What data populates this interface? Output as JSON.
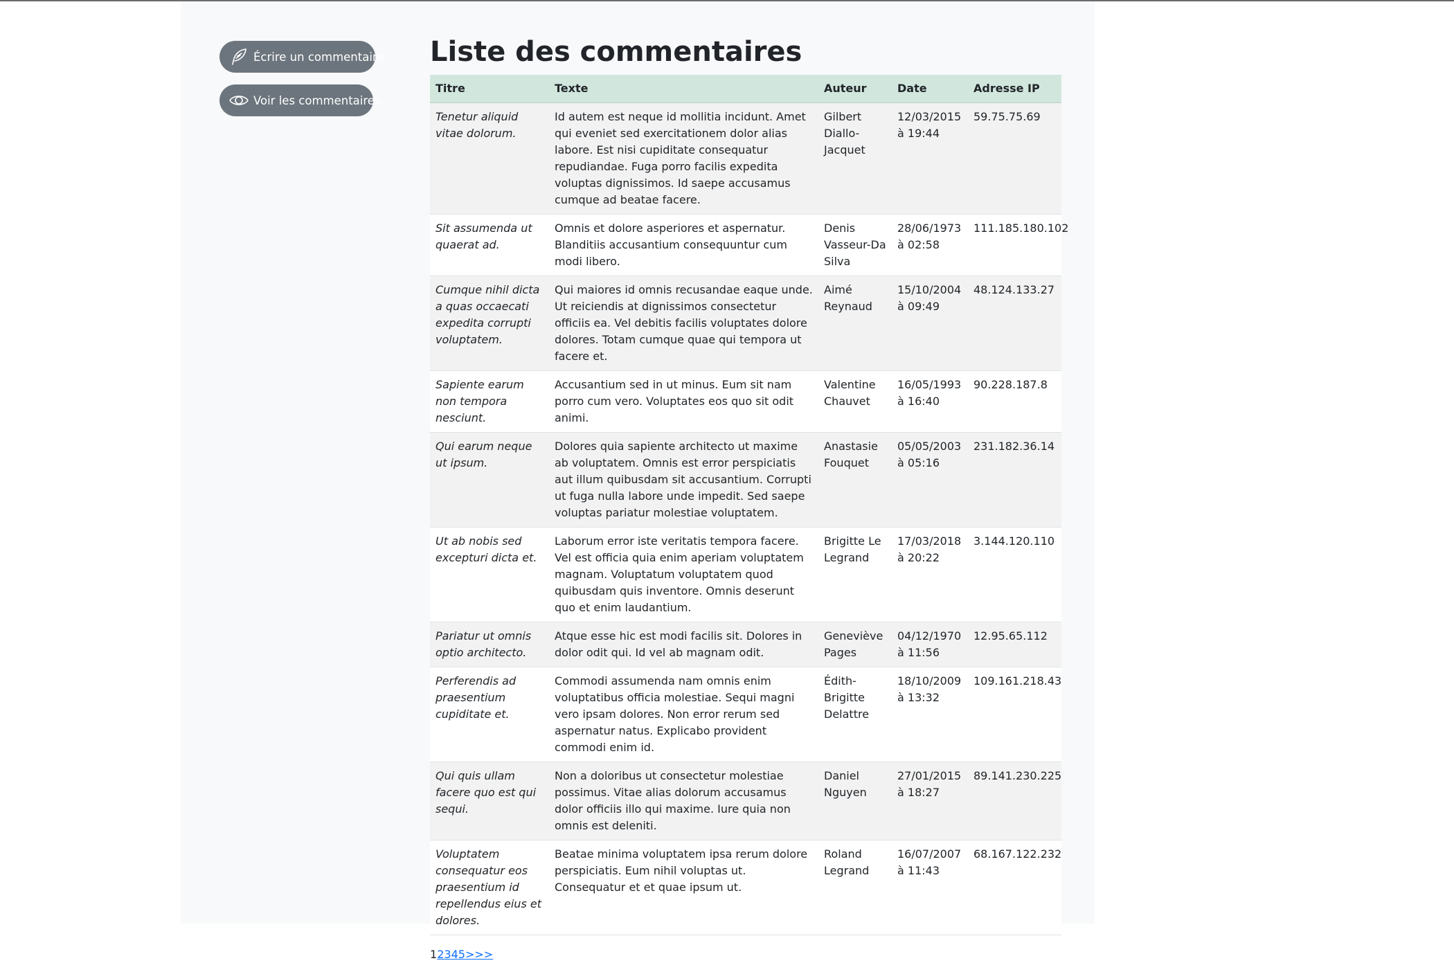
{
  "sidebar": {
    "write_label": "Écrire un commentaire",
    "view_label": "Voir les commentaires"
  },
  "main": {
    "title": "Liste des commentaires",
    "columns": [
      "Titre",
      "Texte",
      "Auteur",
      "Date",
      "Adresse IP"
    ],
    "rows": [
      {
        "title": "Tenetur aliquid vitae dolorum.",
        "text": "Id autem est neque id mollitia incidunt. Amet qui eveniet sed exercitationem dolor alias labore. Est nisi cupiditate consequatur repudiandae. Fuga porro facilis expedita voluptas dignissimos. Id saepe accusamus cumque ad beatae facere.",
        "author": "Gilbert Diallo-Jacquet",
        "date": "12/03/2015 à 19:44",
        "ip": "59.75.75.69"
      },
      {
        "title": "Sit assumenda ut quaerat ad.",
        "text": "Omnis et dolore asperiores et aspernatur. Blanditiis accusantium consequuntur cum modi libero.",
        "author": "Denis Vasseur-Da Silva",
        "date": "28/06/1973 à 02:58",
        "ip": "111.185.180.102"
      },
      {
        "title": "Cumque nihil dicta a quas occaecati expedita corrupti voluptatem.",
        "text": "Qui maiores id omnis recusandae eaque unde. Ut reiciendis at dignissimos consectetur officiis ea. Vel debitis facilis voluptates dolore dolores. Totam cumque quae qui tempora ut facere et.",
        "author": "Aimé Reynaud",
        "date": "15/10/2004 à 09:49",
        "ip": "48.124.133.27"
      },
      {
        "title": "Sapiente earum non tempora nesciunt.",
        "text": "Accusantium sed in ut minus. Eum sit nam porro cum vero. Voluptates eos quo sit odit animi.",
        "author": "Valentine Chauvet",
        "date": "16/05/1993 à 16:40",
        "ip": "90.228.187.8"
      },
      {
        "title": "Qui earum neque ut ipsum.",
        "text": "Dolores quia sapiente architecto ut maxime ab voluptatem. Omnis est error perspiciatis aut illum quibusdam sit accusantium. Corrupti ut fuga nulla labore unde impedit. Sed saepe voluptas pariatur molestiae voluptatem.",
        "author": "Anastasie Fouquet",
        "date": "05/05/2003 à 05:16",
        "ip": "231.182.36.14"
      },
      {
        "title": "Ut ab nobis sed excepturi dicta et.",
        "text": "Laborum error iste veritatis tempora facere. Vel est officia quia enim aperiam voluptatem magnam. Voluptatum voluptatem quod quibusdam quis inventore. Omnis deserunt quo et enim laudantium.",
        "author": "Brigitte Le Legrand",
        "date": "17/03/2018 à 20:22",
        "ip": "3.144.120.110"
      },
      {
        "title": "Pariatur ut omnis optio architecto.",
        "text": "Atque esse hic est modi facilis sit. Dolores in dolor odit qui. Id vel ab magnam odit.",
        "author": "Geneviève Pages",
        "date": "04/12/1970 à 11:56",
        "ip": "12.95.65.112"
      },
      {
        "title": "Perferendis ad praesentium cupiditate et.",
        "text": "Commodi assumenda nam omnis enim voluptatibus officia molestiae. Sequi magni vero ipsam dolores. Non error rerum sed aspernatur natus. Explicabo provident commodi enim id.",
        "author": "Édith-Brigitte Delattre",
        "date": "18/10/2009 à 13:32",
        "ip": "109.161.218.43"
      },
      {
        "title": "Qui quis ullam facere quo est qui sequi.",
        "text": "Non a doloribus ut consectetur molestiae possimus. Vitae alias dolorum accusamus dolor officiis illo qui maxime. Iure quia non omnis est deleniti.",
        "author": "Daniel Nguyen",
        "date": "27/01/2015 à 18:27",
        "ip": "89.141.230.225"
      },
      {
        "title": "Voluptatem consequatur eos praesentium id repellendus eius et dolores.",
        "text": "Beatae minima voluptatem ipsa rerum dolore perspiciatis. Eum nihil voluptas ut. Consequatur et et quae ipsum ut.",
        "author": "Roland Legrand",
        "date": "16/07/2007 à 11:43",
        "ip": "68.167.122.232"
      }
    ]
  },
  "pagination": {
    "current": "1",
    "pages": [
      "2",
      "3",
      "4",
      "5",
      ">>>"
    ]
  },
  "icons": {
    "write": "feather-icon",
    "view": "eye-icon"
  },
  "colors": {
    "button_bg": "#6c757d",
    "header_bg": "#d1e7dd",
    "link": "#0d6efd",
    "container_bg": "#f8f9fa"
  }
}
